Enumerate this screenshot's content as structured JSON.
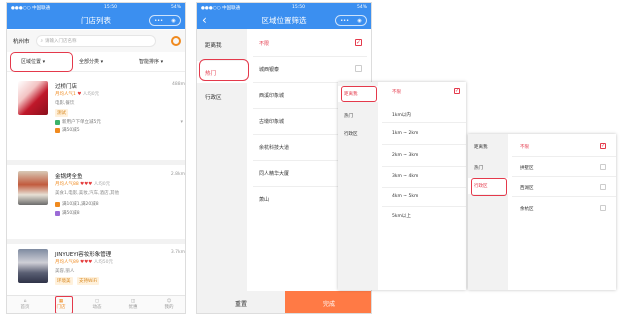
{
  "screen1": {
    "status": {
      "carrier": "●●●○○ 中国联通",
      "wifi": "WiFi",
      "time": "15:50",
      "battery": "54%"
    },
    "title": "门店列表",
    "capsule_dots": "•••",
    "city": "杭州市",
    "search_placeholder": "请输入门店名称",
    "filters": [
      "区域位置",
      "全部分类",
      "智能排序"
    ],
    "stores": [
      {
        "name": "过桥门店",
        "distance": "488m",
        "popularity": "月均人气1",
        "hearts": "♥",
        "people": "人均0元",
        "category": "电影,餐饮",
        "tag": "测试",
        "activities": [
          {
            "icon": "新",
            "text": "新用户下单立减5元"
          },
          {
            "icon": "满",
            "text": "满50减5"
          }
        ]
      },
      {
        "name": "金锅烤全鱼",
        "distance": "2.8km",
        "popularity": "月均人气88",
        "hearts": "♥♥♥",
        "people": "人均0元",
        "category": "美食1,电影,美妆,汽车,酒店,其他",
        "tag": "",
        "activities": [
          {
            "icon": "满",
            "text": "满10减1,满20减8"
          },
          {
            "icon": "折",
            "text": "满50减8"
          }
        ]
      },
      {
        "name": "JINYUEYI容妆形象管理",
        "distance": "3.7km",
        "popularity": "月均人气89",
        "hearts": "♥♥♥",
        "people": "人均50元",
        "category": "美容,丽人",
        "tag": "",
        "activities": [
          {
            "icon": "",
            "text": "环境美"
          },
          {
            "icon": "",
            "text": "支持WiFi"
          }
        ]
      }
    ],
    "tabbar": [
      "首页",
      "门店",
      "动态",
      "优惠",
      "我的"
    ],
    "active_tab": "门店"
  },
  "screen2": {
    "status": {
      "carrier": "●●●○○ 中国联通",
      "wifi": "WiFi",
      "time": "15:50",
      "battery": "54%"
    },
    "title": "区域位置筛选",
    "back": "‹",
    "capsule_dots": "•••",
    "left_menu": [
      "距离我",
      "热门",
      "行政区"
    ],
    "selected_left": "热门",
    "options": [
      "不限",
      "城西银泰",
      "西溪印象城",
      "古墩印象城",
      "余杭科技大道",
      "同人精华大厦",
      "萧山"
    ],
    "selected_option": "不限",
    "reset": "重置",
    "confirm": "完成"
  },
  "panel3": {
    "left_menu": [
      "距离我",
      "热门",
      "行政区"
    ],
    "selected_left": "距离我",
    "options": [
      "不限",
      "1km以内",
      "1km ~ 2km",
      "2km ~ 3km",
      "3km ~ 4km",
      "4km ~ 5km",
      "5km以上"
    ],
    "selected_option": "不限"
  },
  "panel4": {
    "left_menu": [
      "距离我",
      "热门",
      "行政区"
    ],
    "selected_left": "行政区",
    "options": [
      "不限",
      "拱墅区",
      "西湖区",
      "余杭区"
    ],
    "selected_option": "不限"
  },
  "colors": {
    "blue": "#3b8ff0",
    "red": "#e4394b",
    "orange": "#ff7a45"
  }
}
